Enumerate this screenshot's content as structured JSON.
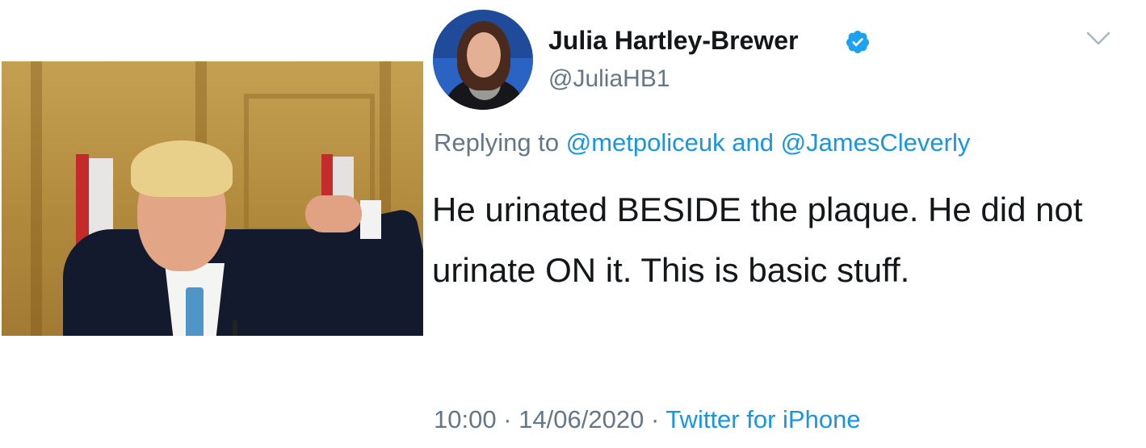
{
  "tweet": {
    "display_name": "Julia Hartley-Brewer",
    "handle": "@JuliaHB1",
    "replying_prefix": "Replying to",
    "reply_mention_1": "@metpoliceuk",
    "reply_and": "and",
    "reply_mention_2": "@JamesCleverly",
    "text": "He urinated BESIDE the plaque. He did not urinate ON it. This is basic stuff.",
    "time": "10:00",
    "date": "14/06/2020",
    "source": "Twitter for iPhone",
    "separator": "·"
  },
  "icons": {
    "verified": "verified-badge-icon",
    "menu": "chevron-down-icon"
  },
  "colors": {
    "link": "#1b95e0",
    "secondary_text": "#657786",
    "primary_text": "#14171a",
    "verified_badge": "#1da1f2"
  }
}
